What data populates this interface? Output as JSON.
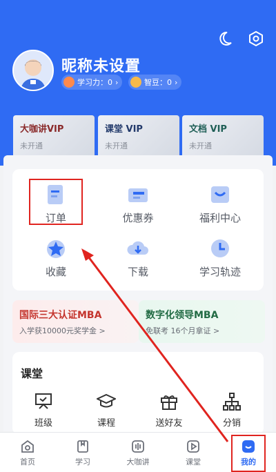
{
  "profile": {
    "nickname": "昵称未设置",
    "study_power_label": "学习力：0",
    "beans_label": "智豆：0"
  },
  "vip_cards": [
    {
      "title": "大咖讲VIP",
      "status": "未开通"
    },
    {
      "title": "课堂 VIP",
      "status": "未开通"
    },
    {
      "title": "文档 VIP",
      "status": "未开通"
    }
  ],
  "grid": [
    {
      "label": "订单",
      "icon": "order-icon"
    },
    {
      "label": "优惠券",
      "icon": "coupon-icon"
    },
    {
      "label": "福利中心",
      "icon": "benefit-icon"
    },
    {
      "label": "收藏",
      "icon": "star-icon"
    },
    {
      "label": "下载",
      "icon": "download-icon"
    },
    {
      "label": "学习轨迹",
      "icon": "clock-icon"
    }
  ],
  "promos": [
    {
      "title": "国际三大认证MBA",
      "subtitle": "入学获10000元奖学金 >"
    },
    {
      "title": "数字化领导MBA",
      "subtitle": "免联考 16个月拿证 >"
    }
  ],
  "course": {
    "title": "课堂",
    "items": [
      {
        "label": "班级",
        "icon": "class-icon"
      },
      {
        "label": "课程",
        "icon": "graduation-cap-icon"
      },
      {
        "label": "送好友",
        "icon": "gift-icon"
      },
      {
        "label": "分销",
        "icon": "distribution-icon"
      }
    ]
  },
  "tabs": [
    {
      "label": "首页",
      "icon": "home-icon"
    },
    {
      "label": "学习",
      "icon": "book-icon"
    },
    {
      "label": "大咖讲",
      "icon": "audio-icon"
    },
    {
      "label": "课堂",
      "icon": "play-icon"
    },
    {
      "label": "我的",
      "icon": "profile-icon"
    }
  ],
  "colors": {
    "brand": "#2f6bf3",
    "highlight": "#e0241f"
  }
}
